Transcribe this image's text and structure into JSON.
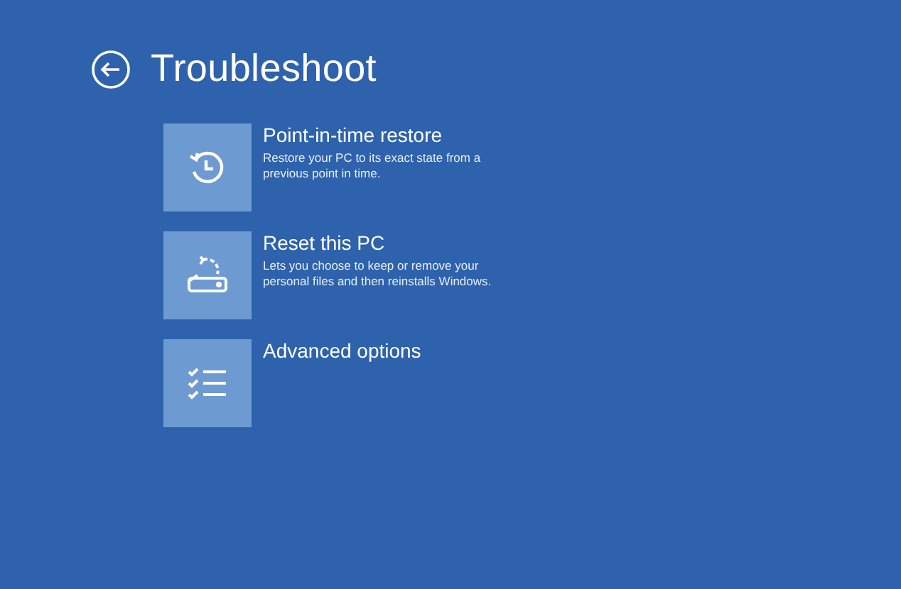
{
  "page": {
    "title": "Troubleshoot"
  },
  "options": [
    {
      "kind": "restore",
      "title": "Point-in-time restore",
      "description": "Restore your PC to its exact state from a previous point in time."
    },
    {
      "kind": "reset",
      "title": "Reset this PC",
      "description": "Lets you choose to keep or remove your personal files and then reinstalls Windows."
    },
    {
      "kind": "advanced",
      "title": "Advanced options"
    }
  ]
}
